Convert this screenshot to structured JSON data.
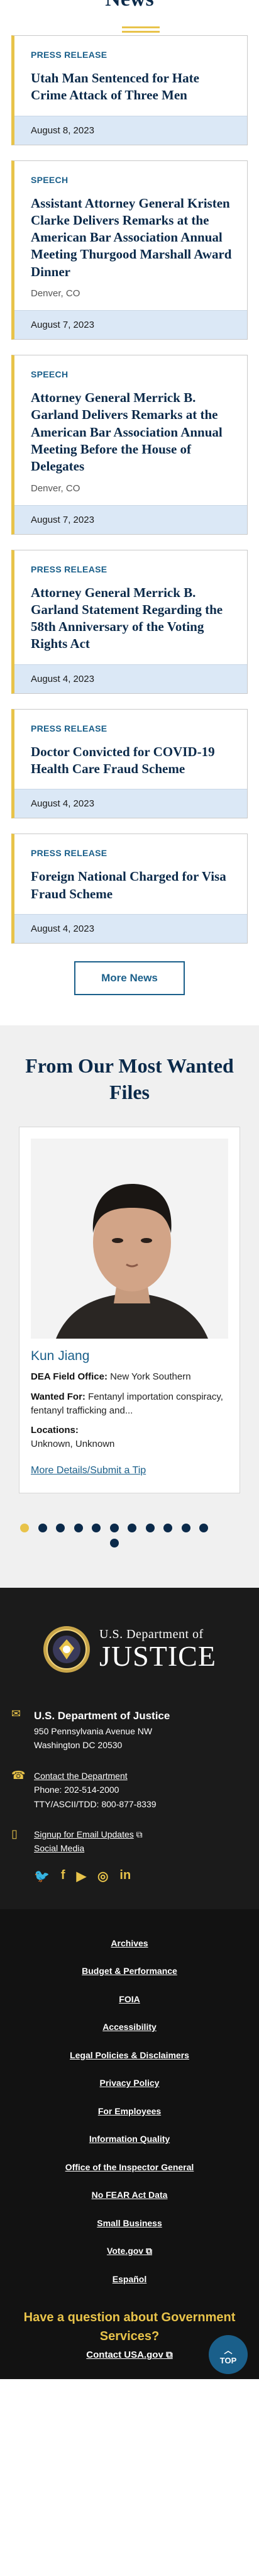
{
  "news": {
    "heading": "News",
    "items": [
      {
        "type": "PRESS RELEASE",
        "title": "Utah Man Sentenced for Hate Crime Attack of Three Men",
        "location": "",
        "date": "August 8, 2023"
      },
      {
        "type": "SPEECH",
        "title": "Assistant Attorney General Kristen Clarke Delivers Remarks at the American Bar Association Annual Meeting Thurgood Marshall Award Dinner",
        "location": "Denver, CO",
        "date": "August 7, 2023"
      },
      {
        "type": "SPEECH",
        "title": "Attorney General Merrick B. Garland Delivers Remarks at the American Bar Association Annual Meeting Before the House of Delegates",
        "location": "Denver, CO",
        "date": "August 7, 2023"
      },
      {
        "type": "PRESS RELEASE",
        "title": "Attorney General Merrick B. Garland Statement Regarding the 58th Anniversary of the Voting Rights Act",
        "location": "",
        "date": "August 4, 2023"
      },
      {
        "type": "PRESS RELEASE",
        "title": "Doctor Convicted for COVID-19 Health Care Fraud Scheme",
        "location": "",
        "date": "August 4, 2023"
      },
      {
        "type": "PRESS RELEASE",
        "title": "Foreign National Charged for Visa Fraud Scheme",
        "location": "",
        "date": "August 4, 2023"
      }
    ],
    "more_label": "More News"
  },
  "wanted": {
    "heading": "From Our Most Wanted Files",
    "name": "Kun Jiang",
    "field_office_label": "DEA Field Office:",
    "field_office": "New York Southern",
    "wanted_for_label": "Wanted For:",
    "wanted_for": "Fentanyl importation conspiracy, fentanyl trafficking and...",
    "locations_label": "Locations:",
    "locations": "Unknown, Unknown",
    "details_link": "More Details/Submit a Tip",
    "carousel": {
      "total": 12,
      "active_index": 0
    }
  },
  "footer": {
    "logo_sub": "U.S. Department of",
    "logo_main": "JUSTICE",
    "org_name": "U.S. Department of Justice",
    "address1": "950 Pennsylvania Avenue NW",
    "address2": "Washington DC 20530",
    "contact_link": "Contact the Department",
    "phone": "Phone: 202-514-2000",
    "tty": "TTY/ASCII/TDD: 800-877-8339",
    "email_updates": "Signup for Email Updates",
    "social_media": "Social Media",
    "links": [
      "Archives",
      "Budget & Performance",
      "FOIA",
      "Accessibility",
      "Legal Policies & Disclaimers",
      "Privacy Policy",
      "For Employees",
      "Information Quality",
      "Office of the Inspector General",
      "No FEAR Act Data",
      "Small Business",
      "Vote.gov",
      "Español"
    ],
    "question": "Have a question about Government Services?",
    "contact_usa": "Contact USA.gov",
    "top_label": "TOP"
  },
  "colors": {
    "navy": "#0b2a4a",
    "gold": "#e8c34a",
    "link_blue": "#1a5f8a",
    "date_band": "#dbe8f6",
    "footer_bg": "#1b1b1b"
  }
}
